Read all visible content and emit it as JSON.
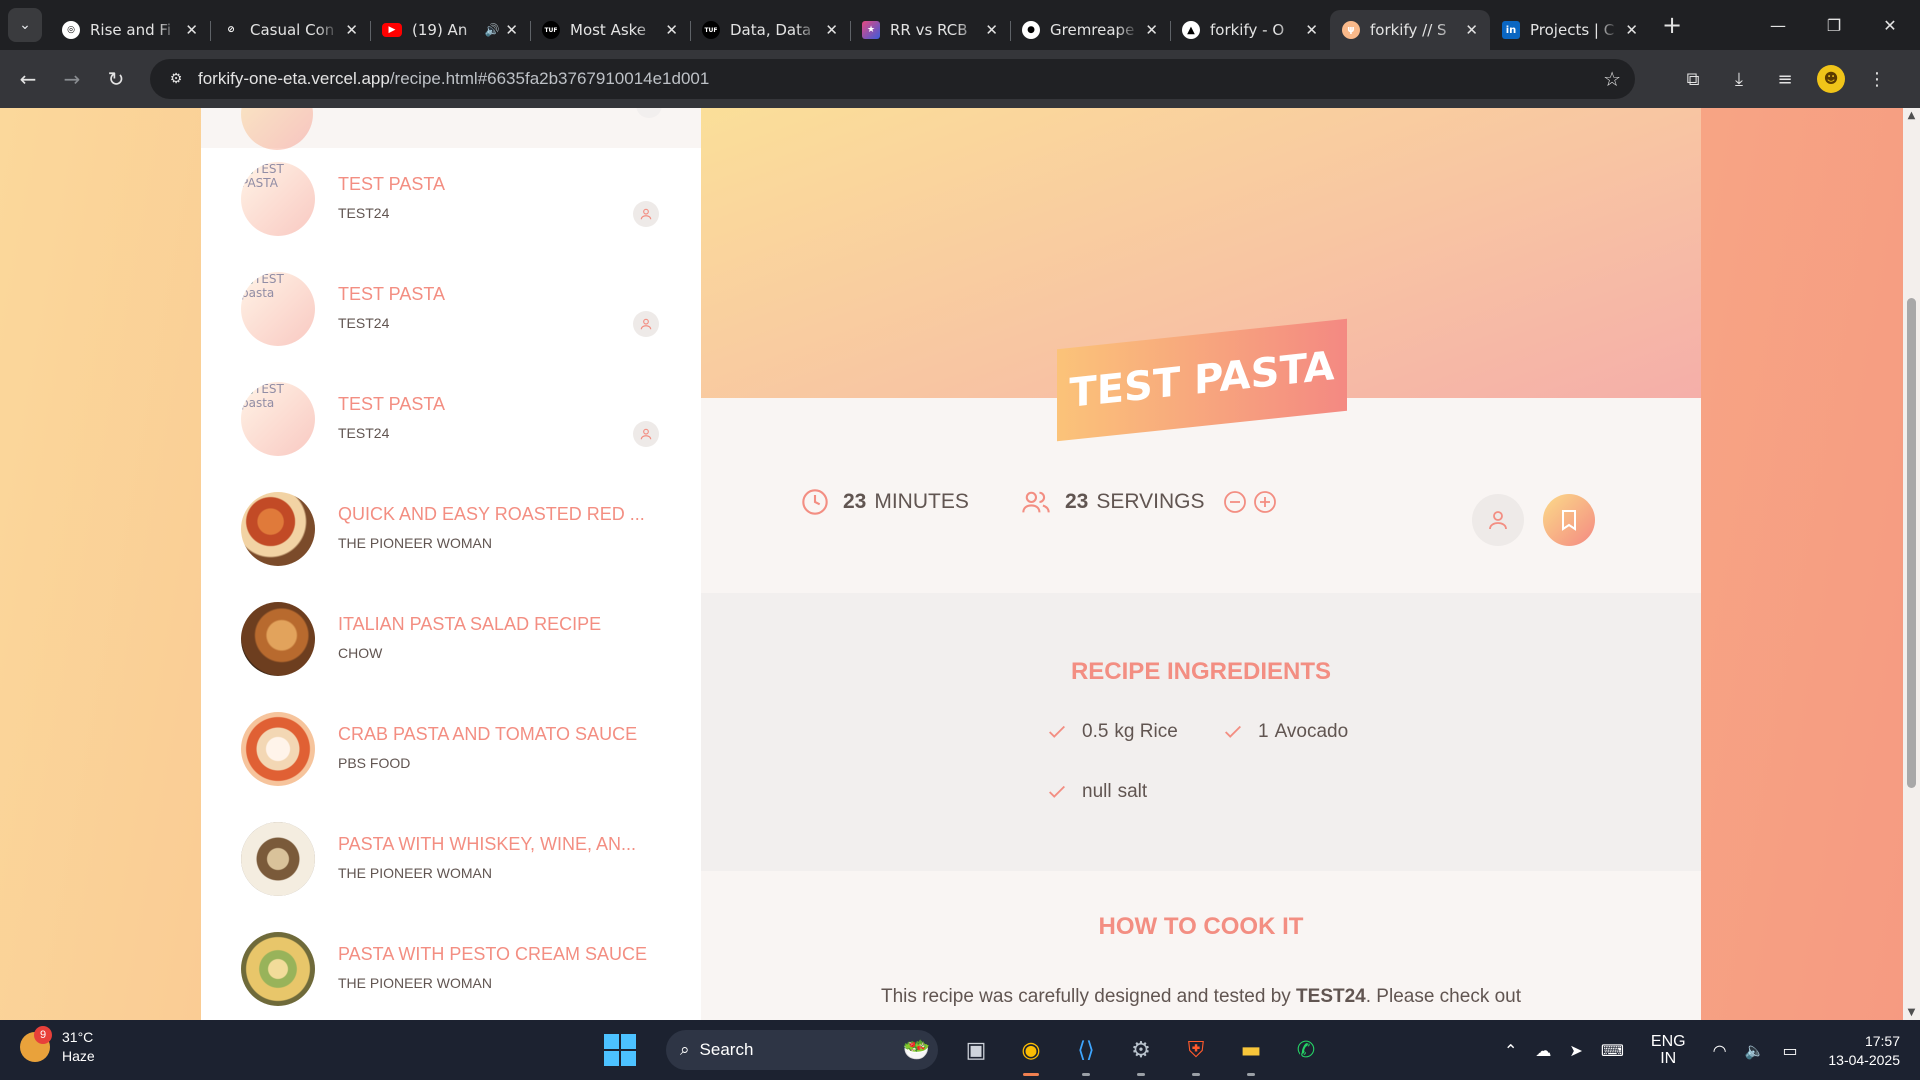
{
  "browser": {
    "tabs": [
      {
        "title": "Rise and Fi",
        "icon": "openai-icon",
        "color": "#ffffff"
      },
      {
        "title": "Casual Con",
        "icon": "link-icon",
        "color": "#ffffff"
      },
      {
        "title": "(19) An",
        "icon": "youtube-icon",
        "color": "#ff0000",
        "audio": true
      },
      {
        "title": "Most Aske",
        "icon": "tuf-icon",
        "color": "#111111"
      },
      {
        "title": "Data, Data",
        "icon": "tuf-icon",
        "color": "#111111"
      },
      {
        "title": "RR vs RCB",
        "icon": "cricket-icon",
        "color": "#3b5bdb"
      },
      {
        "title": "Gremreape",
        "icon": "github-icon",
        "color": "#ffffff"
      },
      {
        "title": "forkify - O",
        "icon": "vercel-icon",
        "color": "#000000"
      },
      {
        "title": "forkify // S",
        "icon": "forkify-icon",
        "color": "#f9b98a",
        "active": true
      },
      {
        "title": "Projects | C",
        "icon": "linkedin-icon",
        "color": "#0a66c2"
      }
    ],
    "url_host": "forkify-one-eta.vercel.app",
    "url_path": "/recipe.html#6635fa2b3767910014e1d001"
  },
  "sidebar": {
    "results": [
      {
        "title": "TEST PASTA",
        "publisher": "TEST24",
        "image_alt": "TEST PASTA",
        "user_generated": true
      },
      {
        "title": "TEST PASTA",
        "publisher": "TEST24",
        "image_alt": "TEST pasta",
        "user_generated": true
      },
      {
        "title": "TEST PASTA",
        "publisher": "TEST24",
        "image_alt": "TEST pasta",
        "user_generated": true
      },
      {
        "title": "QUICK AND EASY ROASTED RED ...",
        "publisher": "THE PIONEER WOMAN"
      },
      {
        "title": "ITALIAN PASTA SALAD RECIPE",
        "publisher": "CHOW"
      },
      {
        "title": "CRAB PASTA AND TOMATO SAUCE",
        "publisher": "PBS FOOD"
      },
      {
        "title": "PASTA WITH WHISKEY, WINE, AN...",
        "publisher": "THE PIONEER WOMAN"
      },
      {
        "title": "PASTA WITH PESTO CREAM SAUCE",
        "publisher": "THE PIONEER WOMAN"
      }
    ]
  },
  "recipe": {
    "title": "TEST PASTA",
    "cooking_time": "23",
    "cooking_time_unit": "MINUTES",
    "servings": "23",
    "servings_unit": "SERVINGS",
    "ingredients_heading": "RECIPE INGREDIENTS",
    "ingredients": [
      {
        "quantity": "0.5",
        "description": "kg Rice"
      },
      {
        "quantity": "1",
        "description": "Avocado"
      },
      {
        "quantity": "null",
        "description": "salt"
      }
    ],
    "directions_heading": "HOW TO COOK IT",
    "directions_text_start": "This recipe was carefully designed and tested by",
    "directions_publisher": "TEST24",
    "directions_text_end": ". Please check out"
  },
  "taskbar": {
    "weather_temp": "31°C",
    "weather_desc": "Haze",
    "weather_badge": "9",
    "search_placeholder": "Search",
    "lang_1": "ENG",
    "lang_2": "IN",
    "time": "17:57",
    "date": "13-04-2025"
  }
}
